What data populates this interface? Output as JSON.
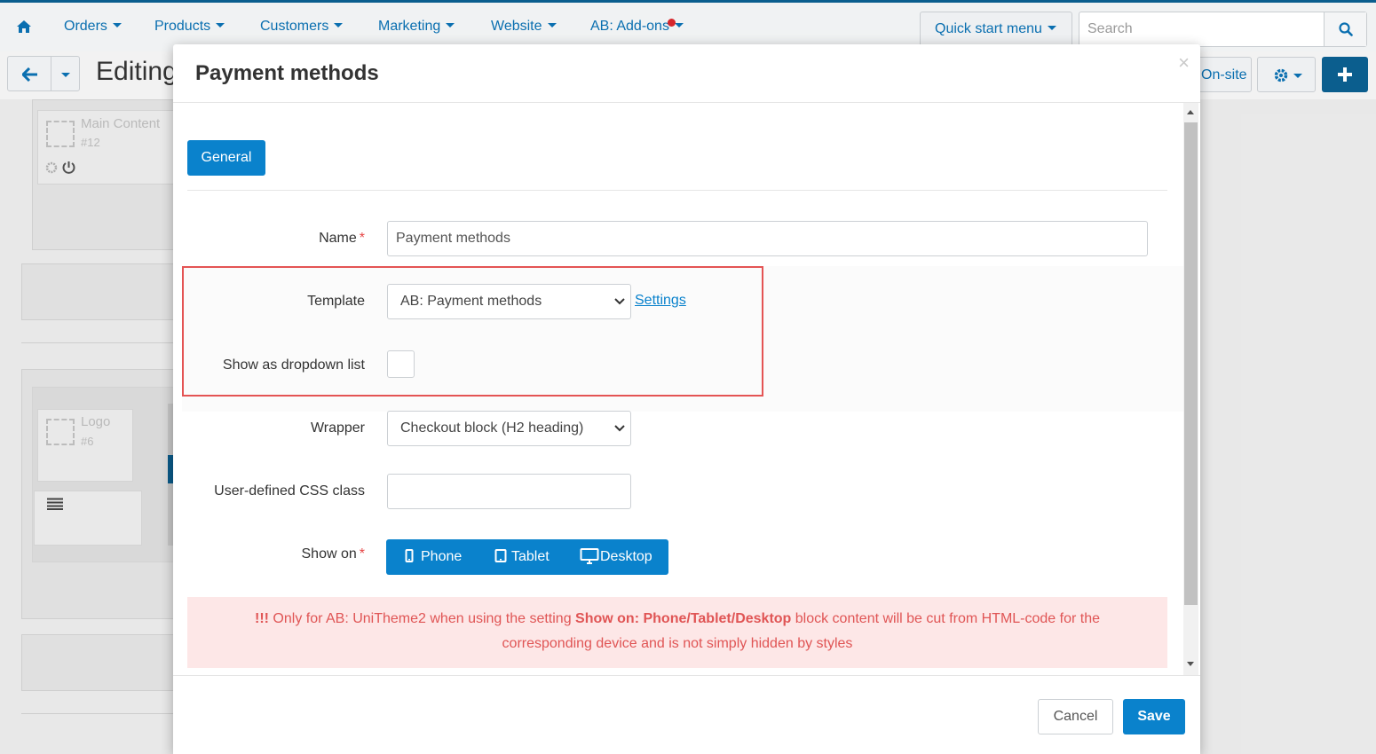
{
  "topnav": {
    "items": [
      {
        "label": "Orders"
      },
      {
        "label": "Products"
      },
      {
        "label": "Customers"
      },
      {
        "label": "Marketing"
      },
      {
        "label": "Website"
      },
      {
        "label": "AB: Add-ons"
      }
    ],
    "quick_start": "Quick start menu",
    "search_placeholder": "Search"
  },
  "toolbar": {
    "page_title": "Editing",
    "onsite_label": "On-site"
  },
  "background": {
    "block_main": "Main Content",
    "block_main_id": "#12",
    "block_logo": "Logo",
    "block_logo_id": "#6"
  },
  "modal": {
    "title": "Payment methods",
    "close_symbol": "×",
    "tab_general": "General",
    "fields": {
      "name_label": "Name",
      "name_value": "Payment methods",
      "template_label": "Template",
      "template_value": "AB: Payment methods",
      "settings_link": "Settings",
      "dropdown_label": "Show as dropdown list",
      "dropdown_checked": false,
      "wrapper_label": "Wrapper",
      "wrapper_value": "Checkout block (H2 heading)",
      "css_label": "User-defined CSS class",
      "css_value": "",
      "show_on_label": "Show on",
      "required_mark": "*"
    },
    "devices": {
      "phone": "Phone",
      "tablet": "Tablet",
      "desktop": "Desktop"
    },
    "notice": {
      "prefix": "!!!",
      "part1": " Only for AB: UniTheme2 when using the setting ",
      "bold": "Show on: Phone/Tablet/Desktop",
      "part2": " block content will be cut from HTML-code for the",
      "line2": "corresponding device and is not simply hidden by styles"
    },
    "cancel_label": "Cancel",
    "save_label": "Save"
  },
  "colors": {
    "accent": "#0a82cc",
    "nav_link": "#0a6fb0",
    "highlight": "#e45454",
    "notice_bg": "#fde7e7",
    "notice_text": "#e05555"
  }
}
